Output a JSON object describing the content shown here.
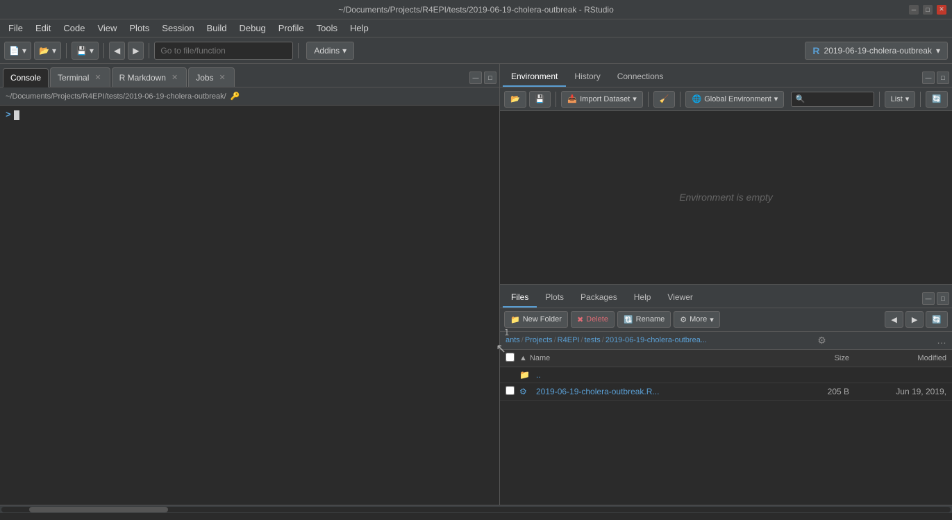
{
  "titleBar": {
    "title": "~/Documents/Projects/R4EPI/tests/2019-06-19-cholera-outbreak - RStudio",
    "controls": [
      "minimize",
      "maximize",
      "close"
    ]
  },
  "menuBar": {
    "items": [
      "File",
      "Edit",
      "Code",
      "View",
      "Plots",
      "Session",
      "Build",
      "Debug",
      "Profile",
      "Tools",
      "Help"
    ]
  },
  "toolbar": {
    "goToFileLabel": "Go to file/function",
    "addinsLabel": "Addins",
    "addinsArrow": "▾",
    "projectLabel": "2019-06-19-cholera-outbreak",
    "projectArrow": "▾"
  },
  "leftPanel": {
    "tabs": [
      {
        "label": "Console",
        "closeable": false
      },
      {
        "label": "Terminal",
        "closeable": true
      },
      {
        "label": "R Markdown",
        "closeable": true
      },
      {
        "label": "Jobs",
        "closeable": true
      }
    ],
    "activeTab": 0,
    "pathBar": "~/Documents/Projects/R4EPI/tests/2019-06-19-cholera-outbreak/",
    "consolePrompt": ">",
    "lineNumber": "1"
  },
  "rightTopPanel": {
    "tabs": [
      "Environment",
      "History",
      "Connections"
    ],
    "activeTab": 0,
    "importDatasetLabel": "Import Dataset",
    "importArrow": "▾",
    "listLabel": "List",
    "listArrow": "▾",
    "globalEnvLabel": "Global Environment",
    "globalEnvArrow": "▾",
    "emptyMessage": "Environment is empty"
  },
  "rightBottomPanel": {
    "tabs": [
      "Files",
      "Plots",
      "Packages",
      "Help",
      "Viewer"
    ],
    "activeTab": 0,
    "toolbar": {
      "newFolderLabel": "New Folder",
      "deleteLabel": "Delete",
      "renameLabel": "Rename",
      "moreLabel": "More",
      "moreArrow": "▾"
    },
    "breadcrumb": {
      "items": [
        "ants",
        "Projects",
        "R4EPI",
        "tests",
        "2019-06-19-cholera-outbrea..."
      ],
      "extraIcon": "…"
    },
    "filesHeader": {
      "nameLabel": "Name",
      "nameSortIcon": "▲",
      "sizeLabel": "Size",
      "modifiedLabel": "Modified"
    },
    "files": [
      {
        "name": "..",
        "icon": "📁",
        "size": "",
        "modified": "",
        "isDir": true
      },
      {
        "name": "2019-06-19-cholera-outbreak.R...",
        "icon": "⚙",
        "size": "205 B",
        "modified": "Jun 19, 2019,",
        "isDir": false
      }
    ]
  },
  "statusBar": {
    "scrollbarVisible": true
  },
  "icons": {
    "search": "🔍",
    "gear": "⚙",
    "folder": "📁",
    "save": "💾",
    "import": "📥",
    "broom": "🧹",
    "refresh": "🔄",
    "back": "◀",
    "forward": "▶",
    "minimize": "─",
    "maximize": "□",
    "close": "✕",
    "newFolder": "📁",
    "delete": "✖",
    "rename": "🔃",
    "more": "⚙",
    "upDir": "⬆",
    "sortAsc": "▲",
    "r_logo": "R",
    "checkmark": "✓",
    "cursor": "↖"
  }
}
